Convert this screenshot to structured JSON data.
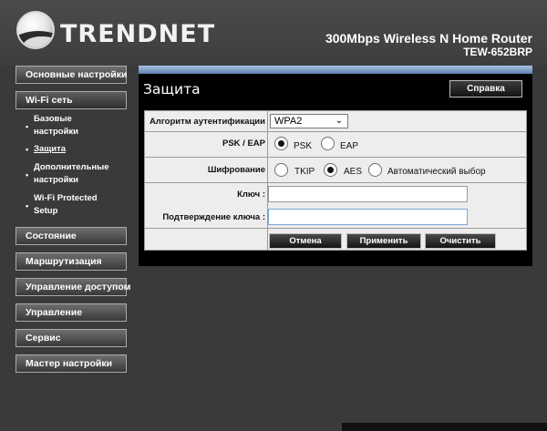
{
  "header": {
    "brand": "TRENDNET",
    "product": "300Mbps Wireless N Home Router",
    "model": "TEW-652BRP"
  },
  "sidebar": {
    "items": [
      {
        "label": "Основные настройки"
      },
      {
        "label": "Wi-Fi сеть"
      },
      {
        "label": "Состояние"
      },
      {
        "label": "Маршрутизация"
      },
      {
        "label": "Управление доступом"
      },
      {
        "label": "Управление"
      },
      {
        "label": "Сервис"
      },
      {
        "label": "Мастер настройки"
      }
    ],
    "wifi_sub": [
      {
        "line1": "Базовые",
        "line2": "настройки"
      },
      {
        "line1": "Защита",
        "line2": ""
      },
      {
        "line1": "Дополнительные",
        "line2": "настройки"
      },
      {
        "line1": "Wi-Fi Protected",
        "line2": "Setup"
      }
    ]
  },
  "page": {
    "title": "Защита",
    "help_label": "Справка"
  },
  "form": {
    "auth_label": "Алгоритм аутентификации",
    "auth_value": "WPA2",
    "psk_eap_label": "PSK / EAP",
    "psk_option": "PSK",
    "eap_option": "EAP",
    "cipher_label": "Шифрование",
    "tkip_option": "TKIP",
    "aes_option": "AES",
    "auto_option": "Автоматический выбор",
    "key_label": "Ключ :",
    "key_value": "",
    "confirm_label": "Подтверждение ключа :",
    "confirm_value": "",
    "selected_psk_eap": "PSK",
    "selected_cipher": "AES"
  },
  "actions": {
    "cancel": "Отмена",
    "apply": "Применить",
    "clear": "Очистить"
  },
  "colors": {
    "accent_bar": "#5f7fae",
    "page_bg": "#3a3a3a",
    "panel_bg": "#000000",
    "form_bg": "#ededed"
  }
}
